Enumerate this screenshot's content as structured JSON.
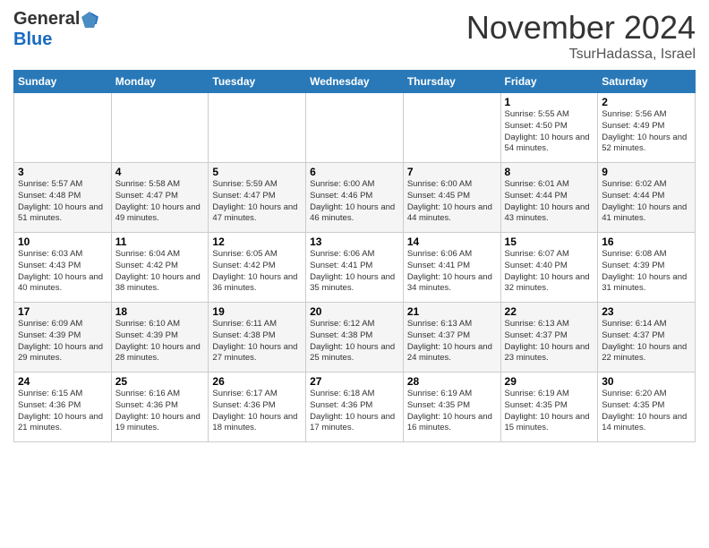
{
  "header": {
    "logo_general": "General",
    "logo_blue": "Blue",
    "month_title": "November 2024",
    "location": "TsurHadassa, Israel"
  },
  "calendar": {
    "days_of_week": [
      "Sunday",
      "Monday",
      "Tuesday",
      "Wednesday",
      "Thursday",
      "Friday",
      "Saturday"
    ],
    "weeks": [
      [
        {
          "day": "",
          "info": ""
        },
        {
          "day": "",
          "info": ""
        },
        {
          "day": "",
          "info": ""
        },
        {
          "day": "",
          "info": ""
        },
        {
          "day": "",
          "info": ""
        },
        {
          "day": "1",
          "info": "Sunrise: 5:55 AM\nSunset: 4:50 PM\nDaylight: 10 hours and 54 minutes."
        },
        {
          "day": "2",
          "info": "Sunrise: 5:56 AM\nSunset: 4:49 PM\nDaylight: 10 hours and 52 minutes."
        }
      ],
      [
        {
          "day": "3",
          "info": "Sunrise: 5:57 AM\nSunset: 4:48 PM\nDaylight: 10 hours and 51 minutes."
        },
        {
          "day": "4",
          "info": "Sunrise: 5:58 AM\nSunset: 4:47 PM\nDaylight: 10 hours and 49 minutes."
        },
        {
          "day": "5",
          "info": "Sunrise: 5:59 AM\nSunset: 4:47 PM\nDaylight: 10 hours and 47 minutes."
        },
        {
          "day": "6",
          "info": "Sunrise: 6:00 AM\nSunset: 4:46 PM\nDaylight: 10 hours and 46 minutes."
        },
        {
          "day": "7",
          "info": "Sunrise: 6:00 AM\nSunset: 4:45 PM\nDaylight: 10 hours and 44 minutes."
        },
        {
          "day": "8",
          "info": "Sunrise: 6:01 AM\nSunset: 4:44 PM\nDaylight: 10 hours and 43 minutes."
        },
        {
          "day": "9",
          "info": "Sunrise: 6:02 AM\nSunset: 4:44 PM\nDaylight: 10 hours and 41 minutes."
        }
      ],
      [
        {
          "day": "10",
          "info": "Sunrise: 6:03 AM\nSunset: 4:43 PM\nDaylight: 10 hours and 40 minutes."
        },
        {
          "day": "11",
          "info": "Sunrise: 6:04 AM\nSunset: 4:42 PM\nDaylight: 10 hours and 38 minutes."
        },
        {
          "day": "12",
          "info": "Sunrise: 6:05 AM\nSunset: 4:42 PM\nDaylight: 10 hours and 36 minutes."
        },
        {
          "day": "13",
          "info": "Sunrise: 6:06 AM\nSunset: 4:41 PM\nDaylight: 10 hours and 35 minutes."
        },
        {
          "day": "14",
          "info": "Sunrise: 6:06 AM\nSunset: 4:41 PM\nDaylight: 10 hours and 34 minutes."
        },
        {
          "day": "15",
          "info": "Sunrise: 6:07 AM\nSunset: 4:40 PM\nDaylight: 10 hours and 32 minutes."
        },
        {
          "day": "16",
          "info": "Sunrise: 6:08 AM\nSunset: 4:39 PM\nDaylight: 10 hours and 31 minutes."
        }
      ],
      [
        {
          "day": "17",
          "info": "Sunrise: 6:09 AM\nSunset: 4:39 PM\nDaylight: 10 hours and 29 minutes."
        },
        {
          "day": "18",
          "info": "Sunrise: 6:10 AM\nSunset: 4:39 PM\nDaylight: 10 hours and 28 minutes."
        },
        {
          "day": "19",
          "info": "Sunrise: 6:11 AM\nSunset: 4:38 PM\nDaylight: 10 hours and 27 minutes."
        },
        {
          "day": "20",
          "info": "Sunrise: 6:12 AM\nSunset: 4:38 PM\nDaylight: 10 hours and 25 minutes."
        },
        {
          "day": "21",
          "info": "Sunrise: 6:13 AM\nSunset: 4:37 PM\nDaylight: 10 hours and 24 minutes."
        },
        {
          "day": "22",
          "info": "Sunrise: 6:13 AM\nSunset: 4:37 PM\nDaylight: 10 hours and 23 minutes."
        },
        {
          "day": "23",
          "info": "Sunrise: 6:14 AM\nSunset: 4:37 PM\nDaylight: 10 hours and 22 minutes."
        }
      ],
      [
        {
          "day": "24",
          "info": "Sunrise: 6:15 AM\nSunset: 4:36 PM\nDaylight: 10 hours and 21 minutes."
        },
        {
          "day": "25",
          "info": "Sunrise: 6:16 AM\nSunset: 4:36 PM\nDaylight: 10 hours and 19 minutes."
        },
        {
          "day": "26",
          "info": "Sunrise: 6:17 AM\nSunset: 4:36 PM\nDaylight: 10 hours and 18 minutes."
        },
        {
          "day": "27",
          "info": "Sunrise: 6:18 AM\nSunset: 4:36 PM\nDaylight: 10 hours and 17 minutes."
        },
        {
          "day": "28",
          "info": "Sunrise: 6:19 AM\nSunset: 4:35 PM\nDaylight: 10 hours and 16 minutes."
        },
        {
          "day": "29",
          "info": "Sunrise: 6:19 AM\nSunset: 4:35 PM\nDaylight: 10 hours and 15 minutes."
        },
        {
          "day": "30",
          "info": "Sunrise: 6:20 AM\nSunset: 4:35 PM\nDaylight: 10 hours and 14 minutes."
        }
      ]
    ]
  }
}
